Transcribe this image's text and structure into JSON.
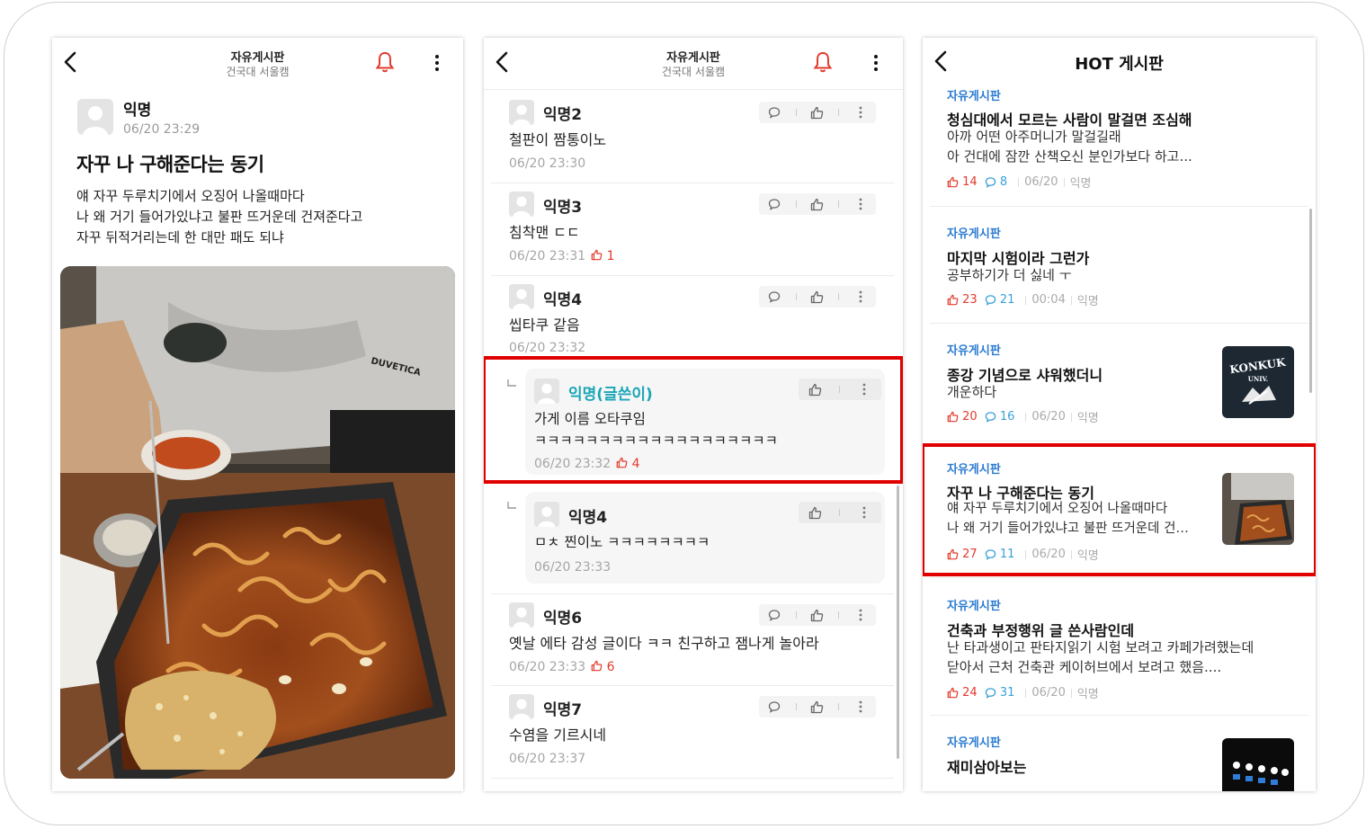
{
  "post_view": {
    "board_title": "자유게시판",
    "school": "건국대 서울캠",
    "author": "익명",
    "date": "06/20 23:29",
    "title": "자꾸 나 구해준다는 동기",
    "body": "얘 자꾸 두루치기에서 오징어 나올때마다\n나 왜 거기 들어가있냐고 불판 뜨거운데 건져준다고\n자꾸 뒤적거리는데 한 대만 패도 되냐",
    "photo_shirt_text": "DUVETICA"
  },
  "comments_view": {
    "board_title": "자유게시판",
    "school": "건국대 서울캠",
    "comments": [
      {
        "name": "익명2",
        "text": "철판이 짬통이노",
        "date": "06/20 23:30",
        "likes": ""
      },
      {
        "name": "익명3",
        "text": "침착맨 ㄷㄷ",
        "date": "06/20 23:31",
        "likes": "1"
      },
      {
        "name": "익명4",
        "text": "씹타쿠 같음",
        "date": "06/20 23:32",
        "likes": ""
      },
      {
        "name": "익명(글쓴이)",
        "text": "가게 이름 오타쿠임\nㅋㅋㅋㅋㅋㅋㅋㅋㅋㅋㅋㅋㅋㅋㅋㅋㅋㅋㅋ",
        "date": "06/20 23:32",
        "likes": "4"
      },
      {
        "name": "익명4",
        "text": "ㅁㅊ 찐이노 ㅋㅋㅋㅋㅋㅋㅋㅋ",
        "date": "06/20 23:33",
        "likes": ""
      },
      {
        "name": "익명6",
        "text": "옛날 에타 감성 글이다 ㅋㅋ 친구하고 잼나게 놀아라",
        "date": "06/20 23:33",
        "likes": "6"
      },
      {
        "name": "익명7",
        "text": "수염을 기르시네",
        "date": "06/20 23:37",
        "likes": ""
      }
    ]
  },
  "hot_view": {
    "title": "HOT 게시판",
    "posts": [
      {
        "board": "자유게시판",
        "title": "청심대에서 모르는 사람이 말걸면 조심해",
        "body": "아까 어떤 아주머니가 말걸길래\n아 건대에 잠깐 산책오신 분인가보다 하고...",
        "likes": "14",
        "comments": "8",
        "date": "06/20",
        "author": "익명"
      },
      {
        "board": "자유게시판",
        "title": "마지막 시험이라 그런가",
        "body": "공부하기가 더 싫네 ㅜ",
        "likes": "23",
        "comments": "21",
        "date": "00:04",
        "author": "익명"
      },
      {
        "board": "자유게시판",
        "title": "종강 기념으로 샤워했더니",
        "body": "개운하다",
        "likes": "20",
        "comments": "16",
        "date": "06/20",
        "author": "익명",
        "thumb_text_1": "KONKUK",
        "thumb_text_2": "UNIV."
      },
      {
        "board": "자유게시판",
        "title": "자꾸 나 구해준다는 동기",
        "body": "얘 자꾸 두루치기에서 오징어 나올때마다\n나 왜 거기 들어가있냐고 불판 뜨거운데 건…",
        "likes": "27",
        "comments": "11",
        "date": "06/20",
        "author": "익명"
      },
      {
        "board": "자유게시판",
        "title": "건축과 부정행위 글 쓴사람인데",
        "body": "난 타과생이고 판타지읽기 시험 보려고 카페가려했는데\n닫아서 근처 건축관 케이허브에서 보려고 했음....",
        "likes": "24",
        "comments": "31",
        "date": "06/20",
        "author": "익명"
      },
      {
        "board": "자유게시판",
        "title": "재미삼아보는",
        "body": "",
        "likes": "",
        "comments": "",
        "date": "",
        "author": ""
      }
    ]
  },
  "colors": {
    "accent_red": "#e23a2d",
    "writer_teal": "#1aa6b7",
    "board_blue": "#2c7bd1",
    "highlight": "#e00000"
  }
}
